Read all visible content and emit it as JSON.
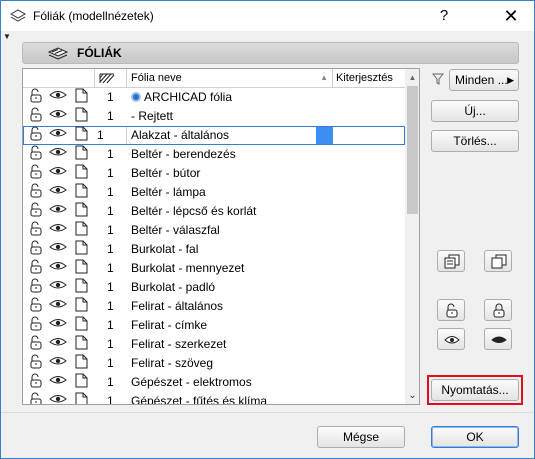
{
  "window": {
    "title": "Fóliák (modellnézetek)",
    "help": "?",
    "close": "✕"
  },
  "header": {
    "title": "FÓLIÁK"
  },
  "table": {
    "columns": {
      "name": "Fólia neve",
      "extension": "Kiterjesztés"
    },
    "selected_extension_color": "#3b8ff0",
    "rows": [
      {
        "num": "1",
        "name": "ARCHICAD fólia",
        "special": true
      },
      {
        "num": "1",
        "name": "- Rejtett"
      },
      {
        "num": "1",
        "name": "Alakzat - általános",
        "selected": true
      },
      {
        "num": "1",
        "name": "Beltér - berendezés"
      },
      {
        "num": "1",
        "name": "Beltér - bútor"
      },
      {
        "num": "1",
        "name": "Beltér - lámpa"
      },
      {
        "num": "1",
        "name": "Beltér - lépcső és korlát"
      },
      {
        "num": "1",
        "name": "Beltér - válaszfal"
      },
      {
        "num": "1",
        "name": "Burkolat - fal"
      },
      {
        "num": "1",
        "name": "Burkolat - mennyezet"
      },
      {
        "num": "1",
        "name": "Burkolat - padló"
      },
      {
        "num": "1",
        "name": "Felirat - általános"
      },
      {
        "num": "1",
        "name": "Felirat - címke"
      },
      {
        "num": "1",
        "name": "Felirat - szerkezet"
      },
      {
        "num": "1",
        "name": "Felirat - szöveg"
      },
      {
        "num": "1",
        "name": "Gépészet - elektromos"
      },
      {
        "num": "1",
        "name": "Gépészet - fűtés és klíma"
      }
    ]
  },
  "side": {
    "filter_label": "Minden ...",
    "new_label": "Új...",
    "delete_label": "Törlés...",
    "print_label": "Nyomtatás..."
  },
  "footer": {
    "cancel_label": "Mégse",
    "ok_label": "OK"
  },
  "colors": {
    "accent": "#3b7ad8",
    "highlight": "#e0101a"
  }
}
